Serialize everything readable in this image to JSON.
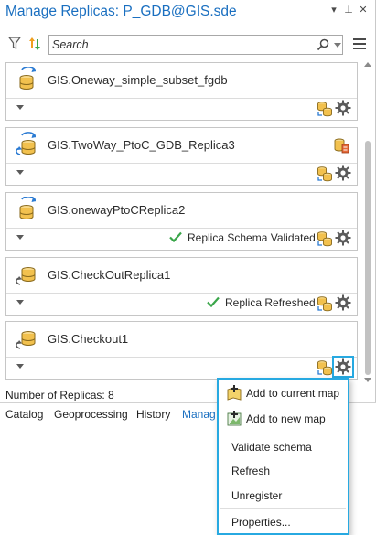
{
  "window": {
    "title": "Manage Replicas: P_GDB@GIS.sde",
    "dropdown_glyph": "▾",
    "pin_glyph": "⊥",
    "close_glyph": "✕"
  },
  "toolbar": {
    "search_placeholder": "Search",
    "icons": [
      "filter-icon",
      "sort-icon",
      "search-icon",
      "hamburger-menu-icon"
    ]
  },
  "replicas": [
    {
      "name": "GIS.Oneway_simple_subset_fgdb",
      "status": "",
      "direction": "one-way-parent",
      "has_top_icon": false
    },
    {
      "name": "GIS.TwoWay_PtoC_GDB_Replica3",
      "status": "",
      "direction": "two-way",
      "has_top_icon": true
    },
    {
      "name": "GIS.onewayPtoCReplica2",
      "status": "Replica Schema Validated",
      "direction": "one-way-parent",
      "has_top_icon": false
    },
    {
      "name": "GIS.CheckOutReplica1",
      "status": "Replica Refreshed",
      "direction": "checkout",
      "has_top_icon": false
    },
    {
      "name": "GIS.Checkout1",
      "status": "",
      "direction": "checkout",
      "has_top_icon": false
    }
  ],
  "footer": {
    "count_text": "Number of Replicas: 8"
  },
  "tabs": [
    {
      "label": "Catalog",
      "active": false
    },
    {
      "label": "Geoprocessing",
      "active": false
    },
    {
      "label": "History",
      "active": false
    },
    {
      "label": "Manag",
      "active": true
    }
  ],
  "context_menu": {
    "items": [
      {
        "label": "Add to current map",
        "icon": "add-to-map-icon"
      },
      {
        "label": "Add to new map",
        "icon": "new-map-icon"
      },
      {
        "label": "Validate schema",
        "icon": ""
      },
      {
        "label": "Refresh",
        "icon": ""
      },
      {
        "label": "Unregister",
        "icon": ""
      },
      {
        "label": "Properties...",
        "icon": ""
      }
    ]
  },
  "colors": {
    "title_blue": "#1a6fc0",
    "highlight_cyan": "#27a9e1",
    "check_green": "#3aa64a",
    "db_yellow": "#f2c14e",
    "arrow_blue": "#2b7bd3"
  }
}
